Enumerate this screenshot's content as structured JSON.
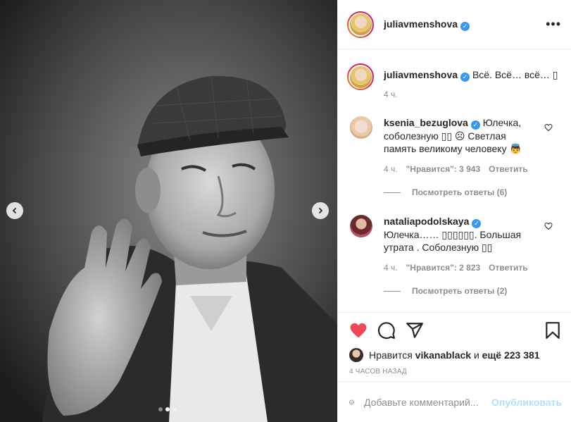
{
  "post": {
    "username": "juliavmenshova",
    "verified_mark": "✓",
    "more_icon": "more-horizontal-icon"
  },
  "caption": {
    "username": "juliavmenshova",
    "text": "Всё. Всё… всё… ▯",
    "time": "4 ч."
  },
  "comments": [
    {
      "username": "ksenia_bezuglova",
      "text": "Юлечка, соболезную ▯▯ ☹ Светлая память великому человеку 👼",
      "time": "4 ч.",
      "likes": "\"Нравится\": 3 943",
      "reply": "Ответить",
      "view_replies": "Посмотреть ответы (6)"
    },
    {
      "username": "nataliapodolskaya",
      "text": "Юлечка…… ▯▯▯▯▯▯. Большая утрата . Соболезную ▯▯",
      "time": "4 ч.",
      "likes": "\"Нравится\": 2 823",
      "reply": "Ответить",
      "view_replies": "Посмотреть ответы (2)"
    }
  ],
  "actions": {
    "like_icon": "heart-filled-icon",
    "comment_icon": "comment-icon",
    "share_icon": "share-icon",
    "save_icon": "bookmark-icon",
    "like_color": "#ed4956"
  },
  "likes": {
    "prefix": "Нравится",
    "user": "vikanablack",
    "middle": "и",
    "rest": "ещё 223 381"
  },
  "post_time": "4 часов назад",
  "add_comment": {
    "placeholder": "Добавьте комментарий...",
    "post_label": "Опубликовать"
  },
  "carousel": {
    "total": 3,
    "active_index": 1
  }
}
